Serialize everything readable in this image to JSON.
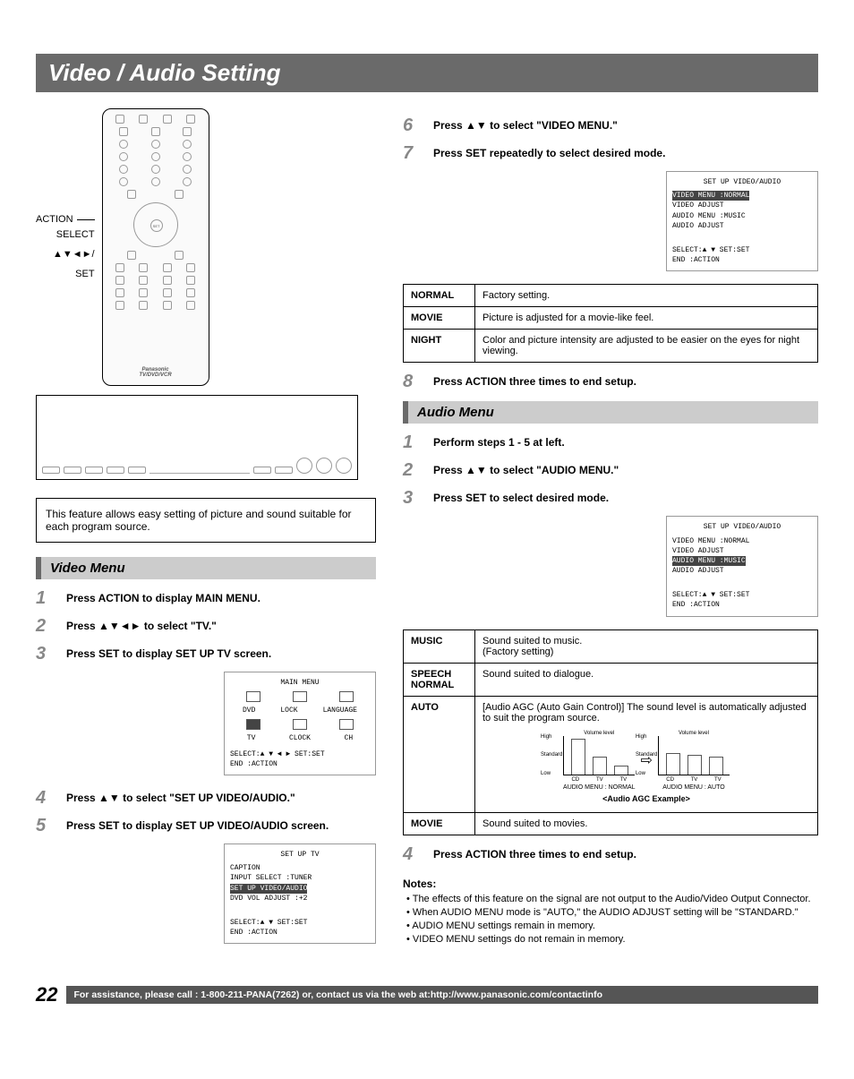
{
  "page_title": "Video / Audio Setting",
  "remote_callouts": {
    "action": "ACTION",
    "select": "SELECT",
    "select_arrows": "▲▼◄►/",
    "set": "SET"
  },
  "remote": {
    "brand": "Panasonic",
    "model_line": "TV/DVD/VCR"
  },
  "intro_text": "This feature allows easy setting of picture and sound suitable for each program source.",
  "video_menu": {
    "header": "Video Menu",
    "steps": [
      "Press ACTION to display MAIN MENU.",
      "Press ▲▼◄► to select \"TV.\"",
      "Press SET to display SET UP TV screen.",
      "Press ▲▼ to select \"SET UP VIDEO/AUDIO.\"",
      "Press SET to display SET UP VIDEO/AUDIO screen."
    ]
  },
  "osd_main_menu": {
    "title": "MAIN MENU",
    "row1": [
      "DVD",
      "LOCK",
      "LANGUAGE"
    ],
    "row2": [
      "TV",
      "CLOCK",
      "CH"
    ],
    "footer1": "SELECT:▲ ▼ ◄ ►   SET:SET",
    "footer2": "END   :ACTION"
  },
  "osd_setup_tv": {
    "title": "SET UP TV",
    "lines": [
      "CAPTION",
      "INPUT SELECT    :TUNER",
      "SET UP VIDEO/AUDIO",
      "DVD VOL ADJUST :+2"
    ],
    "hl_index": 2,
    "footer1": "SELECT:▲ ▼       SET:SET",
    "footer2": "END   :ACTION"
  },
  "right_steps_top": [
    {
      "num": "6",
      "text": "Press ▲▼ to select \"VIDEO MENU.\""
    },
    {
      "num": "7",
      "text": "Press SET repeatedly to select desired mode."
    }
  ],
  "osd_va1": {
    "title": "SET UP VIDEO/AUDIO",
    "lines": [
      "VIDEO MENU    :NORMAL",
      "VIDEO ADJUST",
      "AUDIO MENU    :MUSIC",
      "AUDIO ADJUST"
    ],
    "hl_index": 0,
    "footer1": "SELECT:▲ ▼       SET:SET",
    "footer2": "END   :ACTION"
  },
  "video_modes": [
    {
      "name": "NORMAL",
      "desc": "Factory setting."
    },
    {
      "name": "MOVIE",
      "desc": "Picture is adjusted for a movie-like feel."
    },
    {
      "name": "NIGHT",
      "desc": "Color and picture intensity are adjusted to be easier on the eyes for night viewing."
    }
  ],
  "step8": {
    "num": "8",
    "text": "Press ACTION three times to end setup."
  },
  "audio_menu": {
    "header": "Audio Menu",
    "steps": [
      "Perform steps 1 - 5 at left.",
      "Press ▲▼ to select \"AUDIO MENU.\"",
      "Press SET to select desired mode."
    ]
  },
  "osd_va2": {
    "title": "SET UP VIDEO/AUDIO",
    "lines": [
      "VIDEO MENU    :NORMAL",
      "VIDEO ADJUST",
      "AUDIO MENU    :MUSIC",
      "AUDIO ADJUST"
    ],
    "hl_index": 2,
    "footer1": "SELECT:▲ ▼       SET:SET",
    "footer2": "END   :ACTION"
  },
  "audio_modes": {
    "music": {
      "name": "MUSIC",
      "desc1": "Sound suited to music.",
      "desc2": "(Factory setting)"
    },
    "speech": {
      "name": "SPEECH NORMAL",
      "desc": "Sound suited to dialogue."
    },
    "auto": {
      "name": "AUTO",
      "desc": "[Audio AGC (Auto Gain Control)] The sound level is automatically adjusted to suit the program source.",
      "graph_ylabel": "Volume level",
      "y_hi": "High",
      "y_mid": "Standard",
      "y_lo": "Low",
      "xlabels": [
        "CD",
        "TV",
        "TV"
      ],
      "cap_left": "AUDIO MENU : NORMAL",
      "cap_right": "AUDIO MENU : AUTO",
      "example": "<Audio AGC Example>"
    },
    "movie": {
      "name": "MOVIE",
      "desc": "Sound suited to movies."
    }
  },
  "step_audio4": {
    "num": "4",
    "text": "Press ACTION three times to end setup."
  },
  "notes": {
    "header": "Notes:",
    "items": [
      "The effects of this feature on the signal are not output to the Audio/Video Output Connector.",
      "When AUDIO MENU mode is \"AUTO,\" the AUDIO ADJUST setting will be \"STANDARD.\"",
      "AUDIO MENU settings remain in memory.",
      "VIDEO MENU settings do not remain in memory."
    ]
  },
  "footer": {
    "page_num": "22",
    "text": "For assistance, please call : 1-800-211-PANA(7262) or, contact us via the web at:http://www.panasonic.com/contactinfo"
  }
}
